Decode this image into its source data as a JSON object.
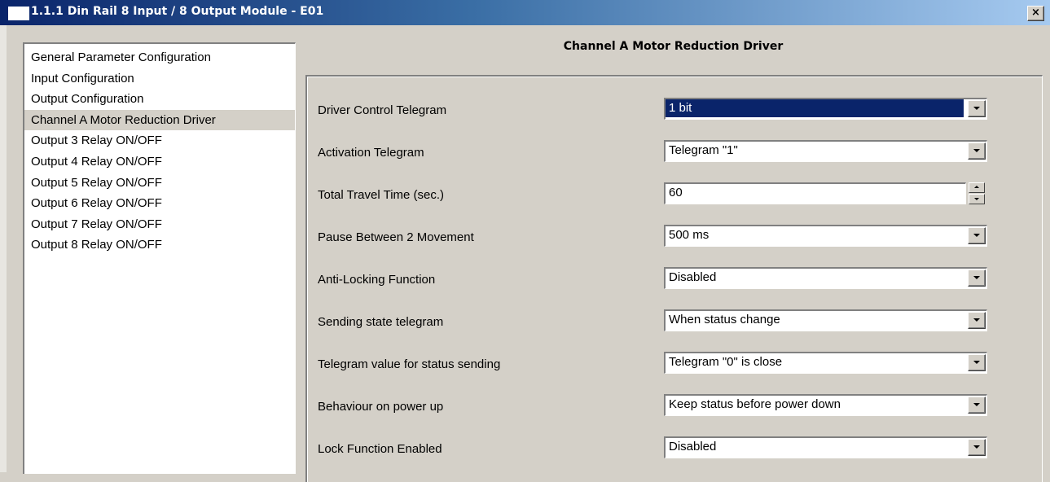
{
  "window": {
    "title": "1.1.1 Din Rail 8 Input / 8 Output Module - E01",
    "close_label": "×"
  },
  "nav": {
    "items": [
      {
        "label": "General Parameter Configuration",
        "selected": false
      },
      {
        "label": "Input Configuration",
        "selected": false
      },
      {
        "label": "Output Configuration",
        "selected": false
      },
      {
        "label": "Channel A Motor Reduction Driver",
        "selected": true
      },
      {
        "label": "Output 3 Relay ON/OFF",
        "selected": false
      },
      {
        "label": "Output 4 Relay ON/OFF",
        "selected": false
      },
      {
        "label": "Output 5 Relay ON/OFF",
        "selected": false
      },
      {
        "label": "Output 6 Relay ON/OFF",
        "selected": false
      },
      {
        "label": "Output 7 Relay ON/OFF",
        "selected": false
      },
      {
        "label": "Output 8 Relay ON/OFF",
        "selected": false
      }
    ]
  },
  "section": {
    "title": "Channel A Motor Reduction Driver"
  },
  "params": {
    "driver_control_telegram": {
      "label": "Driver Control Telegram",
      "value": "1 bit"
    },
    "activation_telegram": {
      "label": "Activation Telegram",
      "value": "Telegram \"1\""
    },
    "total_travel_time": {
      "label": "Total Travel Time (sec.)",
      "value": "60"
    },
    "pause_between_movement": {
      "label": "Pause Between 2 Movement",
      "value": "500 ms"
    },
    "anti_locking_function": {
      "label": "Anti-Locking Function",
      "value": "Disabled"
    },
    "sending_state_telegram": {
      "label": "Sending state telegram",
      "value": "When status change"
    },
    "telegram_value_status": {
      "label": "Telegram value for status sending",
      "value": "Telegram \"0\" is close"
    },
    "behaviour_power_up": {
      "label": "Behaviour on power up",
      "value": "Keep status before power down"
    },
    "lock_function": {
      "label": "Lock Function Enabled",
      "value": "Disabled"
    }
  },
  "icons": {
    "window_icon": "window-icon",
    "dropdown_arrow": "chevron-down-icon",
    "spin_up": "arrow-up-icon",
    "spin_down": "arrow-down-icon"
  },
  "colors": {
    "face": "#d4d0c8",
    "title_start": "#0a246a",
    "title_end": "#a6caf0",
    "selection": "#0a246a"
  }
}
